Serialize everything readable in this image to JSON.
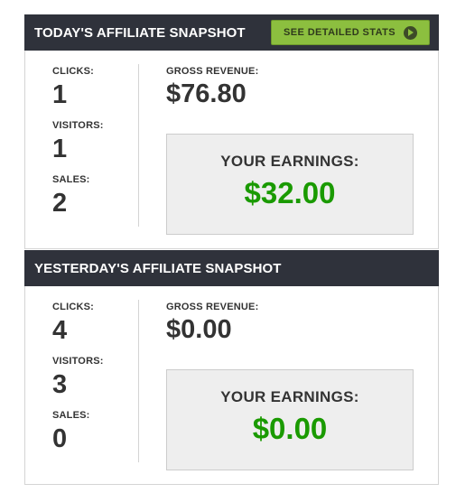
{
  "today": {
    "title": "TODAY'S AFFILIATE SNAPSHOT",
    "button_label": "SEE DETAILED STATS",
    "button_icon": "play-icon",
    "clicks_label": "CLICKS:",
    "clicks_value": "1",
    "visitors_label": "VISITORS:",
    "visitors_value": "1",
    "sales_label": "SALES:",
    "sales_value": "2",
    "gross_label": "GROSS REVENUE:",
    "gross_value": "$76.80",
    "earnings_label": "YOUR EARNINGS:",
    "earnings_value": "$32.00"
  },
  "yesterday": {
    "title": "YESTERDAY'S AFFILIATE SNAPSHOT",
    "clicks_label": "CLICKS:",
    "clicks_value": "4",
    "visitors_label": "VISITORS:",
    "visitors_value": "3",
    "sales_label": "SALES:",
    "sales_value": "0",
    "gross_label": "GROSS REVENUE:",
    "gross_value": "$0.00",
    "earnings_label": "YOUR EARNINGS:",
    "earnings_value": "$0.00"
  },
  "colors": {
    "header_bg": "#2f323b",
    "button_bg": "#8cbf3f",
    "earnings_green": "#1a9a00",
    "box_bg": "#eeeeee"
  }
}
